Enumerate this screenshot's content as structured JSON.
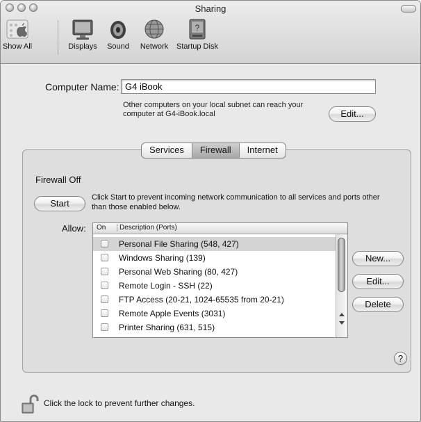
{
  "window": {
    "title": "Sharing"
  },
  "toolbar": {
    "items": [
      {
        "label": "Show All",
        "icon": "apple-grid-icon"
      },
      {
        "label": "Displays",
        "icon": "monitor-icon"
      },
      {
        "label": "Sound",
        "icon": "speaker-icon"
      },
      {
        "label": "Network",
        "icon": "globe-icon"
      },
      {
        "label": "Startup Disk",
        "icon": "hard-disk-icon"
      }
    ]
  },
  "computer_name": {
    "label": "Computer Name:",
    "value": "G4 iBook",
    "hint": "Other computers on your local subnet can reach your computer at G4-iBook.local",
    "edit_label": "Edit..."
  },
  "tabs": [
    {
      "label": "Services",
      "selected": false
    },
    {
      "label": "Firewall",
      "selected": true
    },
    {
      "label": "Internet",
      "selected": false
    }
  ],
  "firewall": {
    "status": "Firewall Off",
    "start_label": "Start",
    "start_description": "Click Start to prevent incoming network communication to all services and ports other than those enabled below.",
    "allow_label": "Allow:",
    "columns": {
      "on": "On",
      "description": "Description (Ports)"
    },
    "rows": [
      {
        "label": "Personal File Sharing (548, 427)",
        "checked": false,
        "selected": true
      },
      {
        "label": "Windows Sharing (139)",
        "checked": false,
        "selected": false
      },
      {
        "label": "Personal Web Sharing (80, 427)",
        "checked": false,
        "selected": false
      },
      {
        "label": "Remote Login - SSH (22)",
        "checked": false,
        "selected": false
      },
      {
        "label": "FTP Access (20-21, 1024-65535 from 20-21)",
        "checked": false,
        "selected": false
      },
      {
        "label": "Remote Apple Events (3031)",
        "checked": false,
        "selected": false
      },
      {
        "label": "Printer Sharing (631, 515)",
        "checked": false,
        "selected": false
      }
    ],
    "buttons": {
      "new": "New...",
      "edit": "Edit...",
      "delete": "Delete"
    }
  },
  "help": {
    "label": "?"
  },
  "lock": {
    "message": "Click the lock to prevent further changes."
  }
}
